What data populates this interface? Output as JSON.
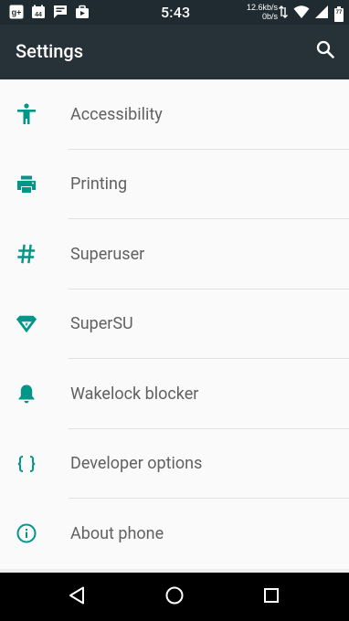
{
  "status_bar": {
    "time": "5:43",
    "net_up": "12.6kb/s",
    "net_down": "0b/s",
    "battery_level": "77",
    "left_icons": [
      "google-plus-icon",
      "calendar-icon",
      "message-icon",
      "briefcase-icon"
    ]
  },
  "app_bar": {
    "title": "Settings",
    "background_color": "#263238"
  },
  "settings_items": [
    {
      "label": "Accessibility",
      "icon": "accessibility-icon"
    },
    {
      "label": "Printing",
      "icon": "printer-icon"
    },
    {
      "label": "Superuser",
      "icon": "hash-icon"
    },
    {
      "label": "SuperSU",
      "icon": "supersu-icon"
    },
    {
      "label": "Wakelock blocker",
      "icon": "bell-icon"
    },
    {
      "label": "Developer options",
      "icon": "braces-icon"
    },
    {
      "label": "About phone",
      "icon": "info-icon"
    }
  ],
  "accent_color": "#009688",
  "nav_bar": {
    "buttons": [
      "back-icon",
      "home-icon",
      "recents-icon"
    ]
  }
}
